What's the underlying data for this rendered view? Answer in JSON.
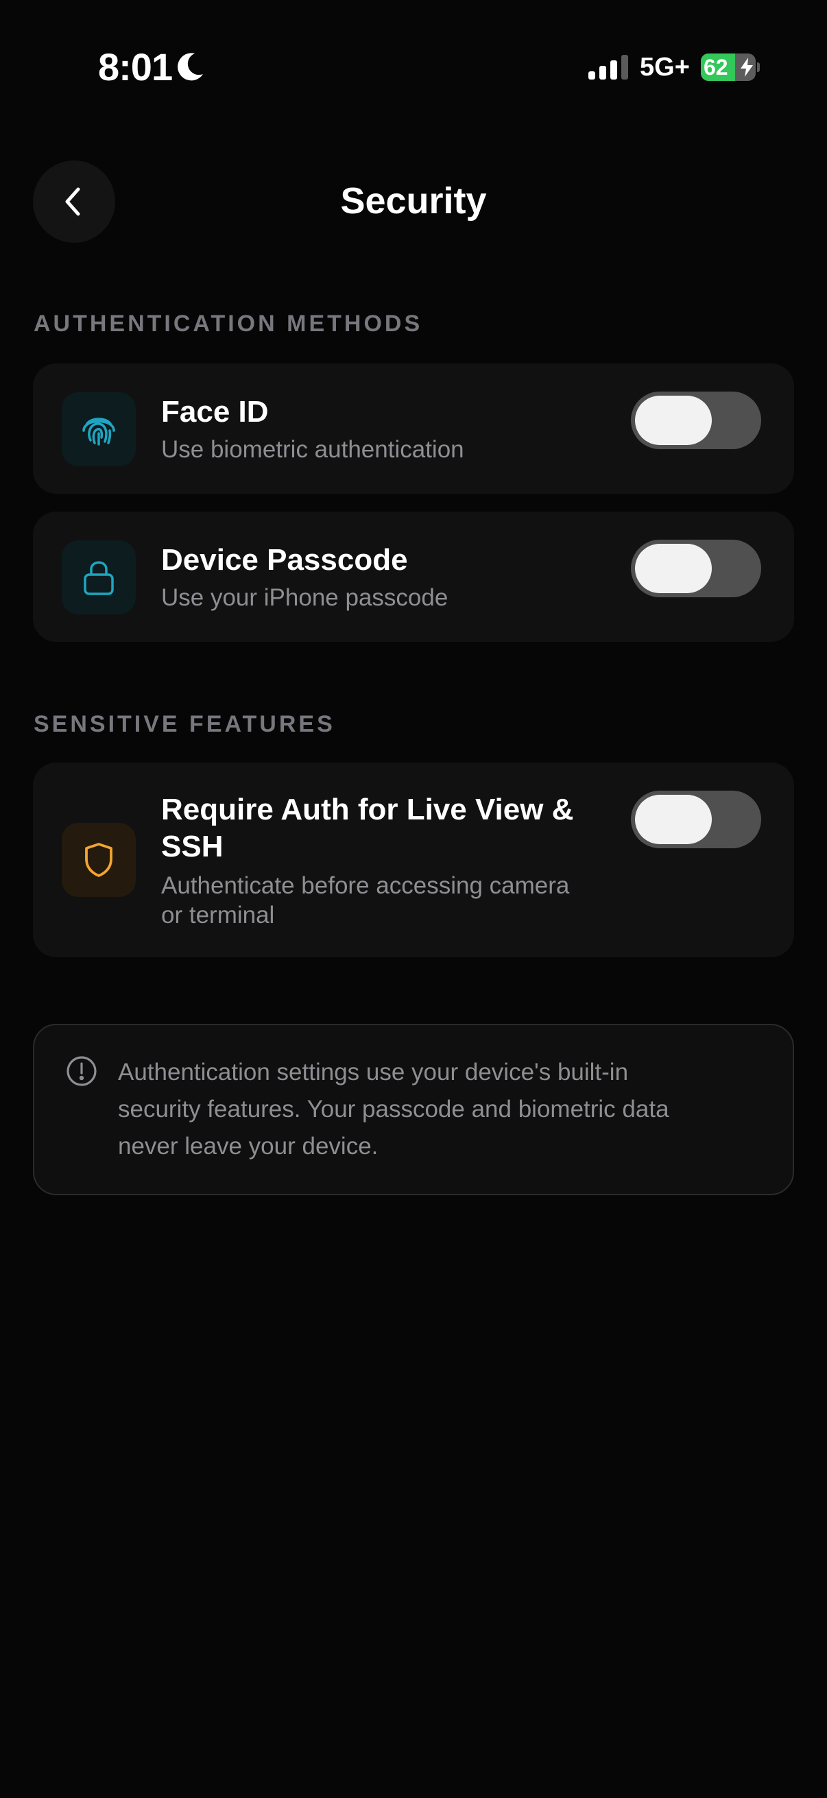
{
  "status_bar": {
    "time": "8:01",
    "network": "5G+",
    "battery_percent": 62,
    "battery_label": "62",
    "icons": [
      "moon-icon",
      "signal-icon",
      "battery-icon",
      "bolt-icon"
    ]
  },
  "header": {
    "title": "Security",
    "back_icon": "chevron-left-icon"
  },
  "sections": {
    "authentication": {
      "header": "AUTHENTICATION METHODS",
      "face_id": {
        "title": "Face ID",
        "subtitle": "Use biometric authentication",
        "icon": "fingerprint-icon",
        "enabled": false
      },
      "passcode": {
        "title": "Device Passcode",
        "subtitle": "Use your iPhone passcode",
        "icon": "lock-icon",
        "enabled": false
      }
    },
    "sensitive": {
      "header": "SENSITIVE FEATURES",
      "require_auth": {
        "title_line1": "Require Auth for Live View &",
        "title_line2": "SSH",
        "subtitle_line1": "Authenticate before accessing camera",
        "subtitle_line2": "or terminal",
        "icon": "shield-icon",
        "enabled": false
      }
    }
  },
  "info": {
    "icon": "info-circle-icon",
    "line1": "Authentication settings use your device's built-in",
    "line2": "security features. Your passcode and biometric data",
    "line3": "never leave your device."
  },
  "colors": {
    "background": "#060606",
    "card": "#111111",
    "accent_teal": "#1fa6c2",
    "accent_amber": "#f2a531",
    "toggle_off": "#505050",
    "battery_green": "#34c759"
  }
}
